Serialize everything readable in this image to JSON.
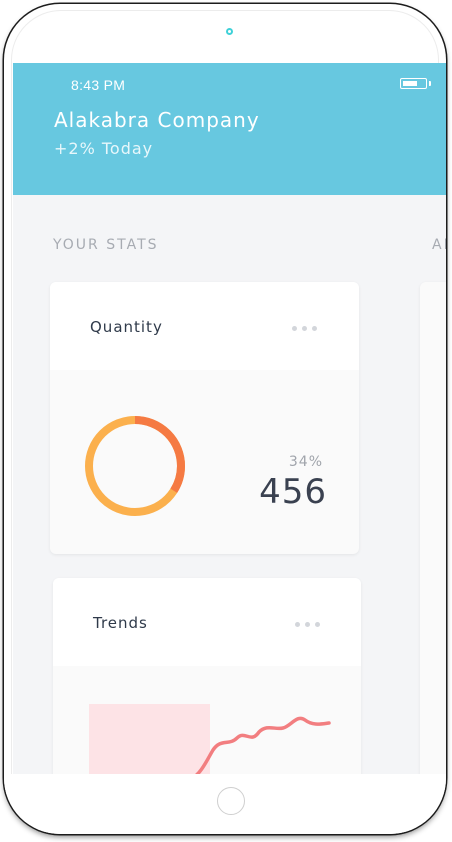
{
  "status_bar": {
    "time": "8:43 PM"
  },
  "header": {
    "company": "Alakabra Company",
    "change": "+2% Today"
  },
  "sections": {
    "stats_title": "YOUR STATS",
    "next_title": "AB"
  },
  "quantity_card": {
    "title": "Quantity",
    "percent_label": "34%",
    "value": "456",
    "ring_fraction": 0.34,
    "colors": {
      "base": "#fbb04d",
      "accent": "#f57a43"
    }
  },
  "trends_card": {
    "title": "Trends",
    "colors": {
      "area": "#fde3e6",
      "line": "#f27e80"
    }
  },
  "icons": {
    "more": "more-horizontal-icon",
    "home": "home-button-icon",
    "battery": "battery-icon"
  },
  "colors": {
    "header": "#67c8e0",
    "background": "#f4f5f7"
  }
}
